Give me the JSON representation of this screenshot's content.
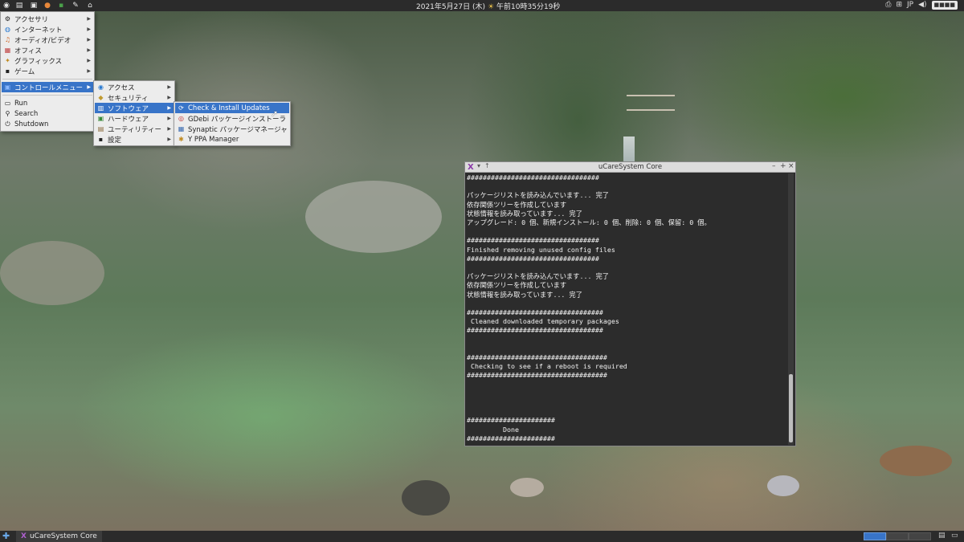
{
  "top_panel": {
    "launchers": [
      "app-menu-icon",
      "files-icon",
      "terminal-icon",
      "firefox-icon",
      "settings-icon",
      "notes-icon",
      "home-icon"
    ],
    "clock": "2021年5月27日 (木)",
    "time": "午前10時35分19秒",
    "weather_icon": "sun-cloud-icon",
    "lang": "JP",
    "user": "■■■■"
  },
  "main_menu": {
    "items": [
      {
        "label": "アクセサリ",
        "icon": "accessories-icon"
      },
      {
        "label": "インターネット",
        "icon": "internet-icon"
      },
      {
        "label": "オーディオ/ビデオ",
        "icon": "media-icon"
      },
      {
        "label": "オフィス",
        "icon": "office-icon"
      },
      {
        "label": "グラフィックス",
        "icon": "graphics-icon"
      },
      {
        "label": "ゲーム",
        "icon": "games-icon"
      },
      {
        "label": "コントロールメニュー",
        "icon": "control-menu-icon"
      },
      {
        "label": "Run",
        "icon": "run-icon"
      },
      {
        "label": "Search",
        "icon": "search-icon"
      },
      {
        "label": "Shutdown",
        "icon": "shutdown-icon"
      }
    ]
  },
  "control_menu": {
    "items": [
      {
        "label": "アクセス",
        "icon": "access-icon"
      },
      {
        "label": "セキュリティ",
        "icon": "security-icon"
      },
      {
        "label": "ソフトウェア",
        "icon": "software-icon"
      },
      {
        "label": "ハードウェア",
        "icon": "hardware-icon"
      },
      {
        "label": "ユーティリティー",
        "icon": "utility-icon"
      },
      {
        "label": "設定",
        "icon": "settings-icon"
      }
    ]
  },
  "software_menu": {
    "items": [
      {
        "label": "Check & Install Updates",
        "icon": "update-icon"
      },
      {
        "label": "GDebi パッケージインストーラ",
        "icon": "gdebi-icon"
      },
      {
        "label": "Synaptic パッケージマネージャ",
        "icon": "synaptic-icon"
      },
      {
        "label": "Y PPA Manager",
        "icon": "ppa-icon"
      }
    ]
  },
  "window": {
    "title": "uCareSystem Core",
    "buttons": [
      "minimize",
      "maximize",
      "close"
    ],
    "terminal_lines": [
      "#################################",
      "",
      "パッケージリストを読み込んでいます... 完了",
      "依存関係ツリーを作成しています",
      "状態情報を読み取っています... 完了",
      "アップグレード: 0 個、新規インストール: 0 個、削除: 0 個、保留: 0 個。",
      "",
      "#################################",
      "Finished removing unused config files",
      "#################################",
      "",
      "パッケージリストを読み込んでいます... 完了",
      "依存関係ツリーを作成しています",
      "状態情報を読み取っています... 完了",
      "",
      "##################################",
      " Cleaned downloaded temporary packages",
      "##################################",
      "",
      "",
      "###################################",
      " Checking to see if a reboot is required",
      "###################################",
      "",
      "",
      "",
      "",
      "######################",
      "         Done",
      "######################"
    ]
  },
  "taskbar": {
    "task_label": "uCareSystem Core",
    "workspaces": 4,
    "active_workspace": 1
  },
  "colors": {
    "panel": "#2b2b2b",
    "highlight": "#3874c8",
    "terminal_bg": "#2c2c2c"
  }
}
